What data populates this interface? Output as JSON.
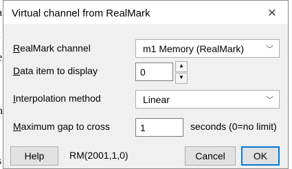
{
  "background": {
    "letters": [
      "a",
      "t",
      "e",
      "n",
      "s"
    ]
  },
  "dialog": {
    "title": "Virtual channel from RealMark",
    "close_icon": "close-icon"
  },
  "fields": {
    "channel": {
      "label_prefix": "",
      "label_mnemonic": "R",
      "label_rest": "ealMark channel",
      "value": "m1 Memory (RealMark)"
    },
    "data_item": {
      "label_mnemonic": "D",
      "label_rest": "ata item to display",
      "value": "0"
    },
    "interpolation": {
      "label_mnemonic": "I",
      "label_rest": "nterpolation method",
      "value": "Linear"
    },
    "max_gap": {
      "label_mnemonic": "M",
      "label_rest": "aximum gap to cross",
      "value": "1",
      "suffix": "seconds (0=no limit)"
    }
  },
  "footer": {
    "help_label": "Help",
    "status_text": "RM(2001,1,0)",
    "cancel_label": "Cancel",
    "ok_label": "OK"
  }
}
